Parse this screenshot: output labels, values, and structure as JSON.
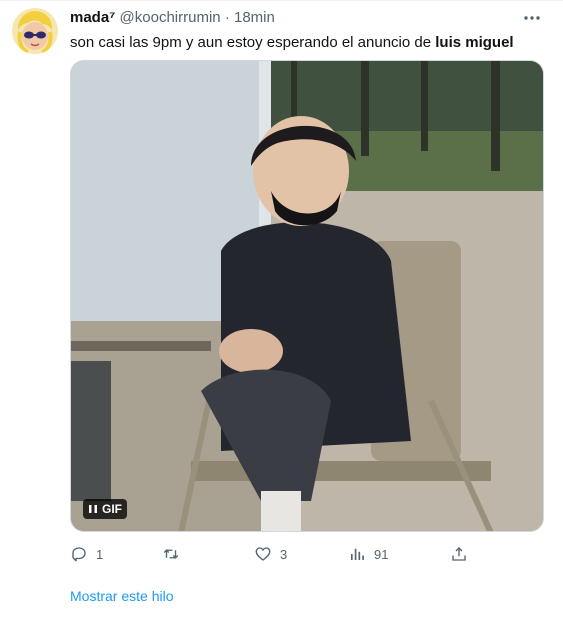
{
  "tweet": {
    "author_name": "mada⁷",
    "handle": "@koochirrumin",
    "separator": "·",
    "time": "18min",
    "text_prefix": "son casi las 9pm y aun estoy esperando el anuncio de ",
    "text_bold": "luis miguel"
  },
  "media": {
    "badge_label": "GIF",
    "pause_icon": "pause-icon"
  },
  "actions": {
    "reply_count": "1",
    "retweet_count": "",
    "like_count": "3",
    "views_count": "91"
  },
  "thread_link": "Mostrar este hilo",
  "colors": {
    "link": "#1d9bf0",
    "muted": "#536471",
    "text": "#0f1419"
  }
}
